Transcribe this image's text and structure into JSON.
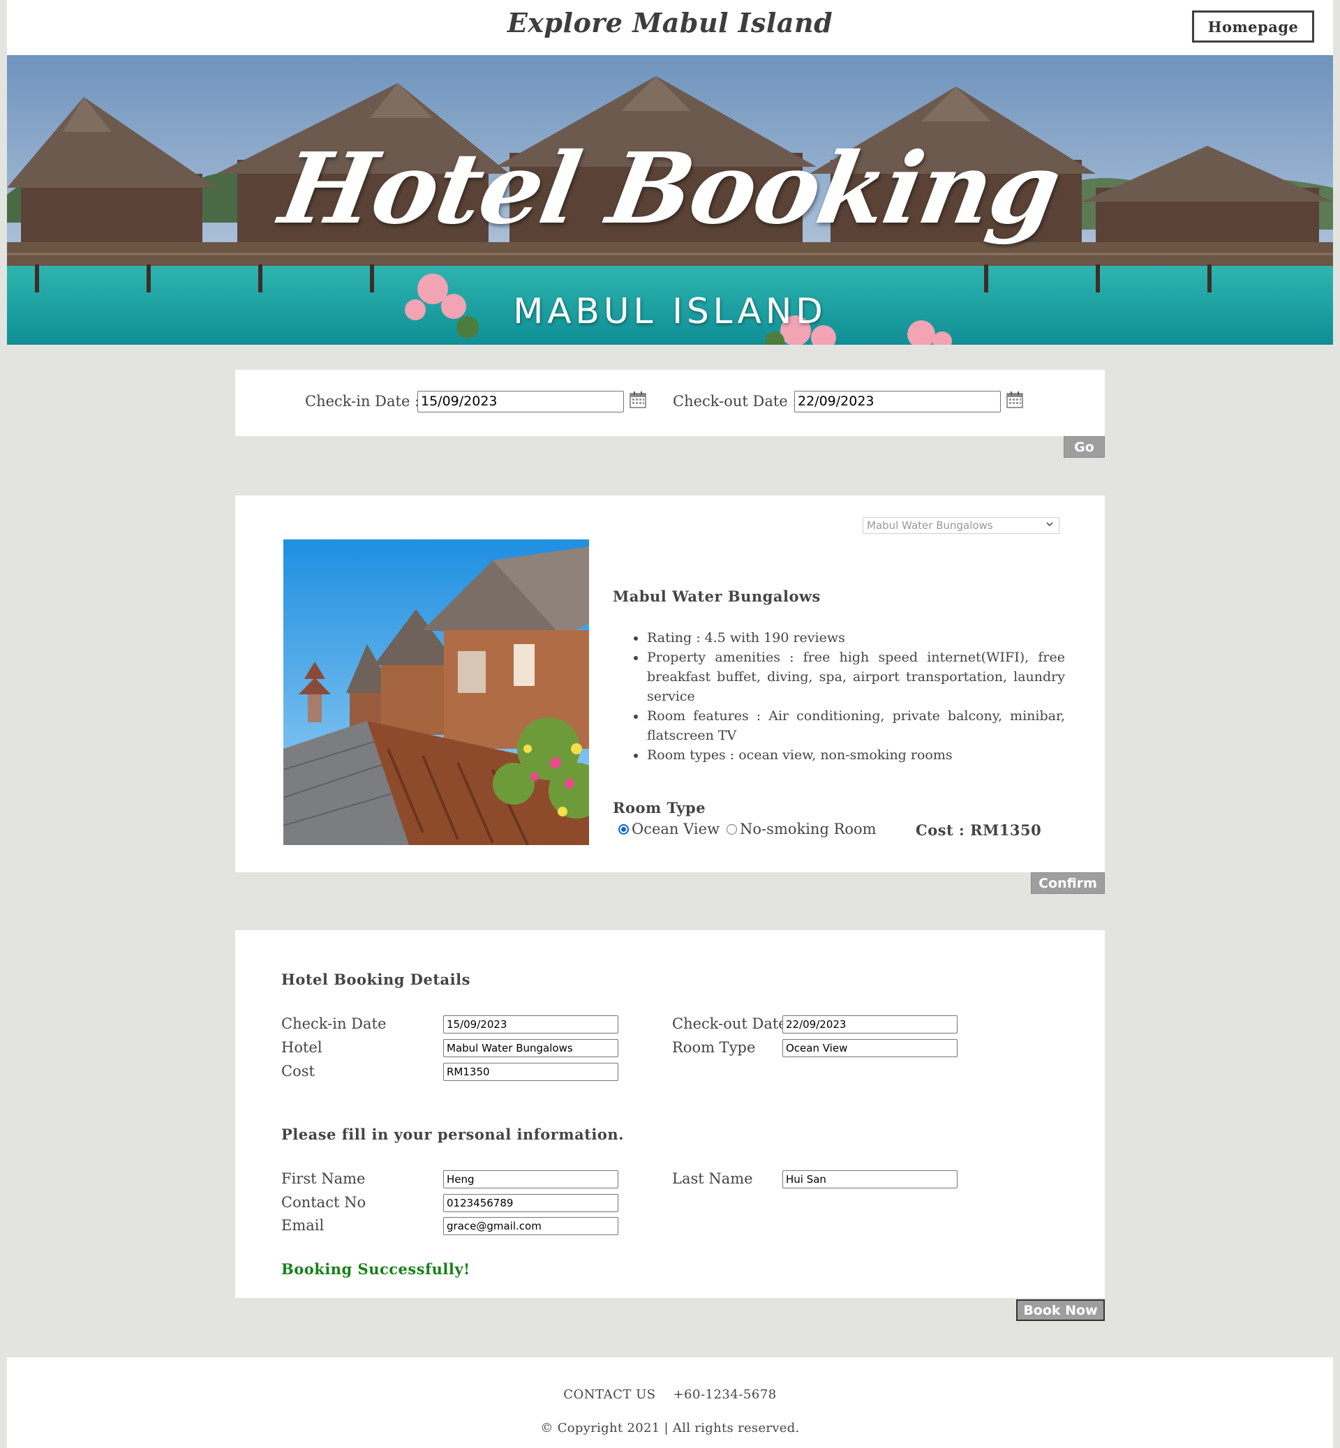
{
  "header": {
    "site_title": "Explore Mabul Island",
    "homepage_label": "Homepage"
  },
  "hero": {
    "title": "Hotel Booking",
    "subtitle": "MABUL ISLAND"
  },
  "date_search": {
    "checkin_label": "Check-in Date :",
    "checkin_value": "15/09/2023",
    "checkout_label": "Check-out Date :",
    "checkout_value": "22/09/2023",
    "go_label": "Go"
  },
  "hotel": {
    "selected_hotel": "Mabul Water Bungalows",
    "name": "Mabul Water Bungalows",
    "features": [
      "Rating : 4.5 with 190 reviews",
      "Property amenities : free high speed internet(WIFI), free breakfast buffet, diving, spa, airport transportation, laundry service",
      "Room features : Air conditioning, private balcony, minibar, flatscreen TV",
      "Room types : ocean view, non-smoking rooms"
    ],
    "room_type_title": "Room Type",
    "room_options": [
      "Ocean View",
      "No-smoking Room"
    ],
    "selected_room": "Ocean View",
    "cost_text": "Cost : RM1350",
    "confirm_label": "Confirm"
  },
  "booking": {
    "details_title": "Hotel Booking Details",
    "checkin_label": "Check-in Date",
    "checkin_value": "15/09/2023",
    "checkout_label": "Check-out Date",
    "checkout_value": "22/09/2023",
    "hotel_label": "Hotel",
    "hotel_value": "Mabul Water Bungalows",
    "room_type_label": "Room Type",
    "room_type_value": "Ocean View",
    "cost_label": "Cost",
    "cost_value": "RM1350",
    "personal_title": "Please fill in your personal information.",
    "first_name_label": "First Name",
    "first_name_value": "Heng",
    "last_name_label": "Last Name",
    "last_name_value": "Hui San",
    "contact_label": "Contact No",
    "contact_value": "0123456789",
    "email_label": "Email",
    "email_value": "grace@gmail.com",
    "success_message": "Booking Successfully!",
    "book_now_label": "Book Now"
  },
  "footer": {
    "contact": "CONTACT US    +60-1234-5678",
    "copyright": "© Copyright 2021 | All rights reserved."
  },
  "colors": {
    "page_bg": "#e3e4e0",
    "button_gray": "#9e9e9e",
    "success_green": "#178017",
    "radio_blue": "#0a66d4"
  }
}
